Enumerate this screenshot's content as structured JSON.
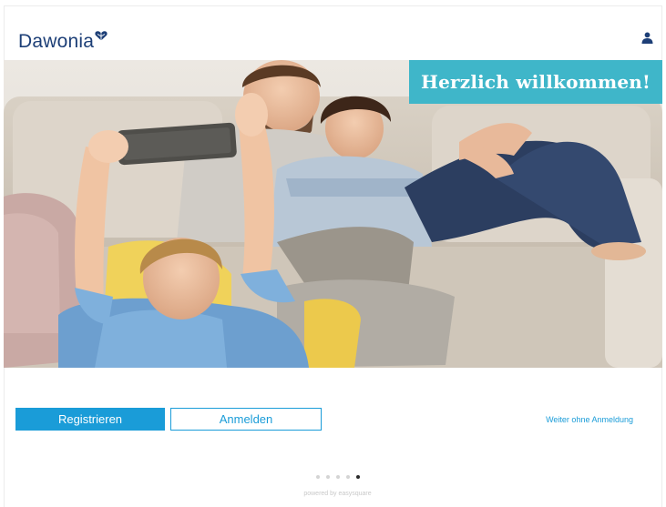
{
  "header": {
    "logo_text": "Dawonia",
    "logo_icon": "heart-logo-icon",
    "user_icon": "user-icon"
  },
  "hero": {
    "banner_text": "Herzlich willkommen!",
    "image_subject": "family-on-sofa-photo"
  },
  "actions": {
    "register_label": "Registrieren",
    "login_label": "Anmelden",
    "skip_label": "Weiter ohne Anmeldung"
  },
  "pager": {
    "count": 5,
    "active_index": 4
  },
  "footer": {
    "powered_text": "powered by easysquare"
  },
  "colors": {
    "brand_navy": "#1d3f77",
    "accent_blue": "#1a9cd8",
    "banner_teal": "#3fb6c9"
  }
}
